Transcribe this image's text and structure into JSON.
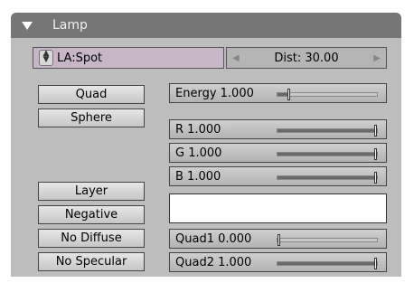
{
  "panel": {
    "title": "Lamp"
  },
  "lamp_datablock": {
    "name": "LA:Spot"
  },
  "dist": {
    "label": "Dist: 30.00"
  },
  "buttons": {
    "quad": "Quad",
    "sphere": "Sphere",
    "layer": "Layer",
    "negative": "Negative",
    "no_diffuse": "No Diffuse",
    "no_specular": "No Specular"
  },
  "sliders": {
    "energy": {
      "label": "Energy 1.000",
      "fraction": 0.1
    },
    "r": {
      "label": "R 1.000",
      "fraction": 1.0
    },
    "g": {
      "label": "G 1.000",
      "fraction": 1.0
    },
    "b": {
      "label": "B 1.000",
      "fraction": 1.0
    },
    "quad1": {
      "label": "Quad1 0.000",
      "fraction": 0.0
    },
    "quad2": {
      "label": "Quad2 1.000",
      "fraction": 1.0
    }
  },
  "color_swatch": "#ffffff",
  "colors": {
    "header": "#767676",
    "panel": "#bdbdbd",
    "datablock": "#c7b5c8"
  }
}
